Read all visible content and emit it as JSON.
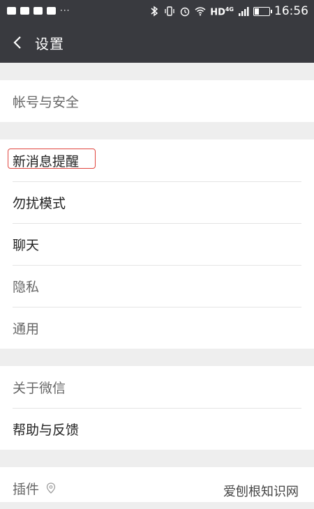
{
  "status_bar": {
    "icons_left": [
      "image-icon",
      "app-grid-icon",
      "app-grid-icon",
      "app-grid-icon"
    ],
    "more": "···",
    "icons_right": [
      "bluetooth-icon",
      "vibrate-icon",
      "alarm-icon",
      "wifi-icon"
    ],
    "network_label": "HD",
    "network_type": "4G",
    "time": "16:56"
  },
  "header": {
    "title": "设置"
  },
  "groups": [
    {
      "items": [
        {
          "label": "帐号与安全"
        }
      ]
    },
    {
      "items": [
        {
          "label": "新消息提醒"
        },
        {
          "label": "勿扰模式"
        },
        {
          "label": "聊天"
        },
        {
          "label": "隐私"
        },
        {
          "label": "通用"
        }
      ]
    },
    {
      "items": [
        {
          "label": "关于微信"
        },
        {
          "label": "帮助与反馈"
        }
      ]
    },
    {
      "items": [
        {
          "label": "插件"
        }
      ]
    }
  ],
  "watermark": "爱刨根知识网",
  "colors": {
    "bar": "#393a3f",
    "background": "#eeeeee",
    "highlight": "#e0453e"
  }
}
